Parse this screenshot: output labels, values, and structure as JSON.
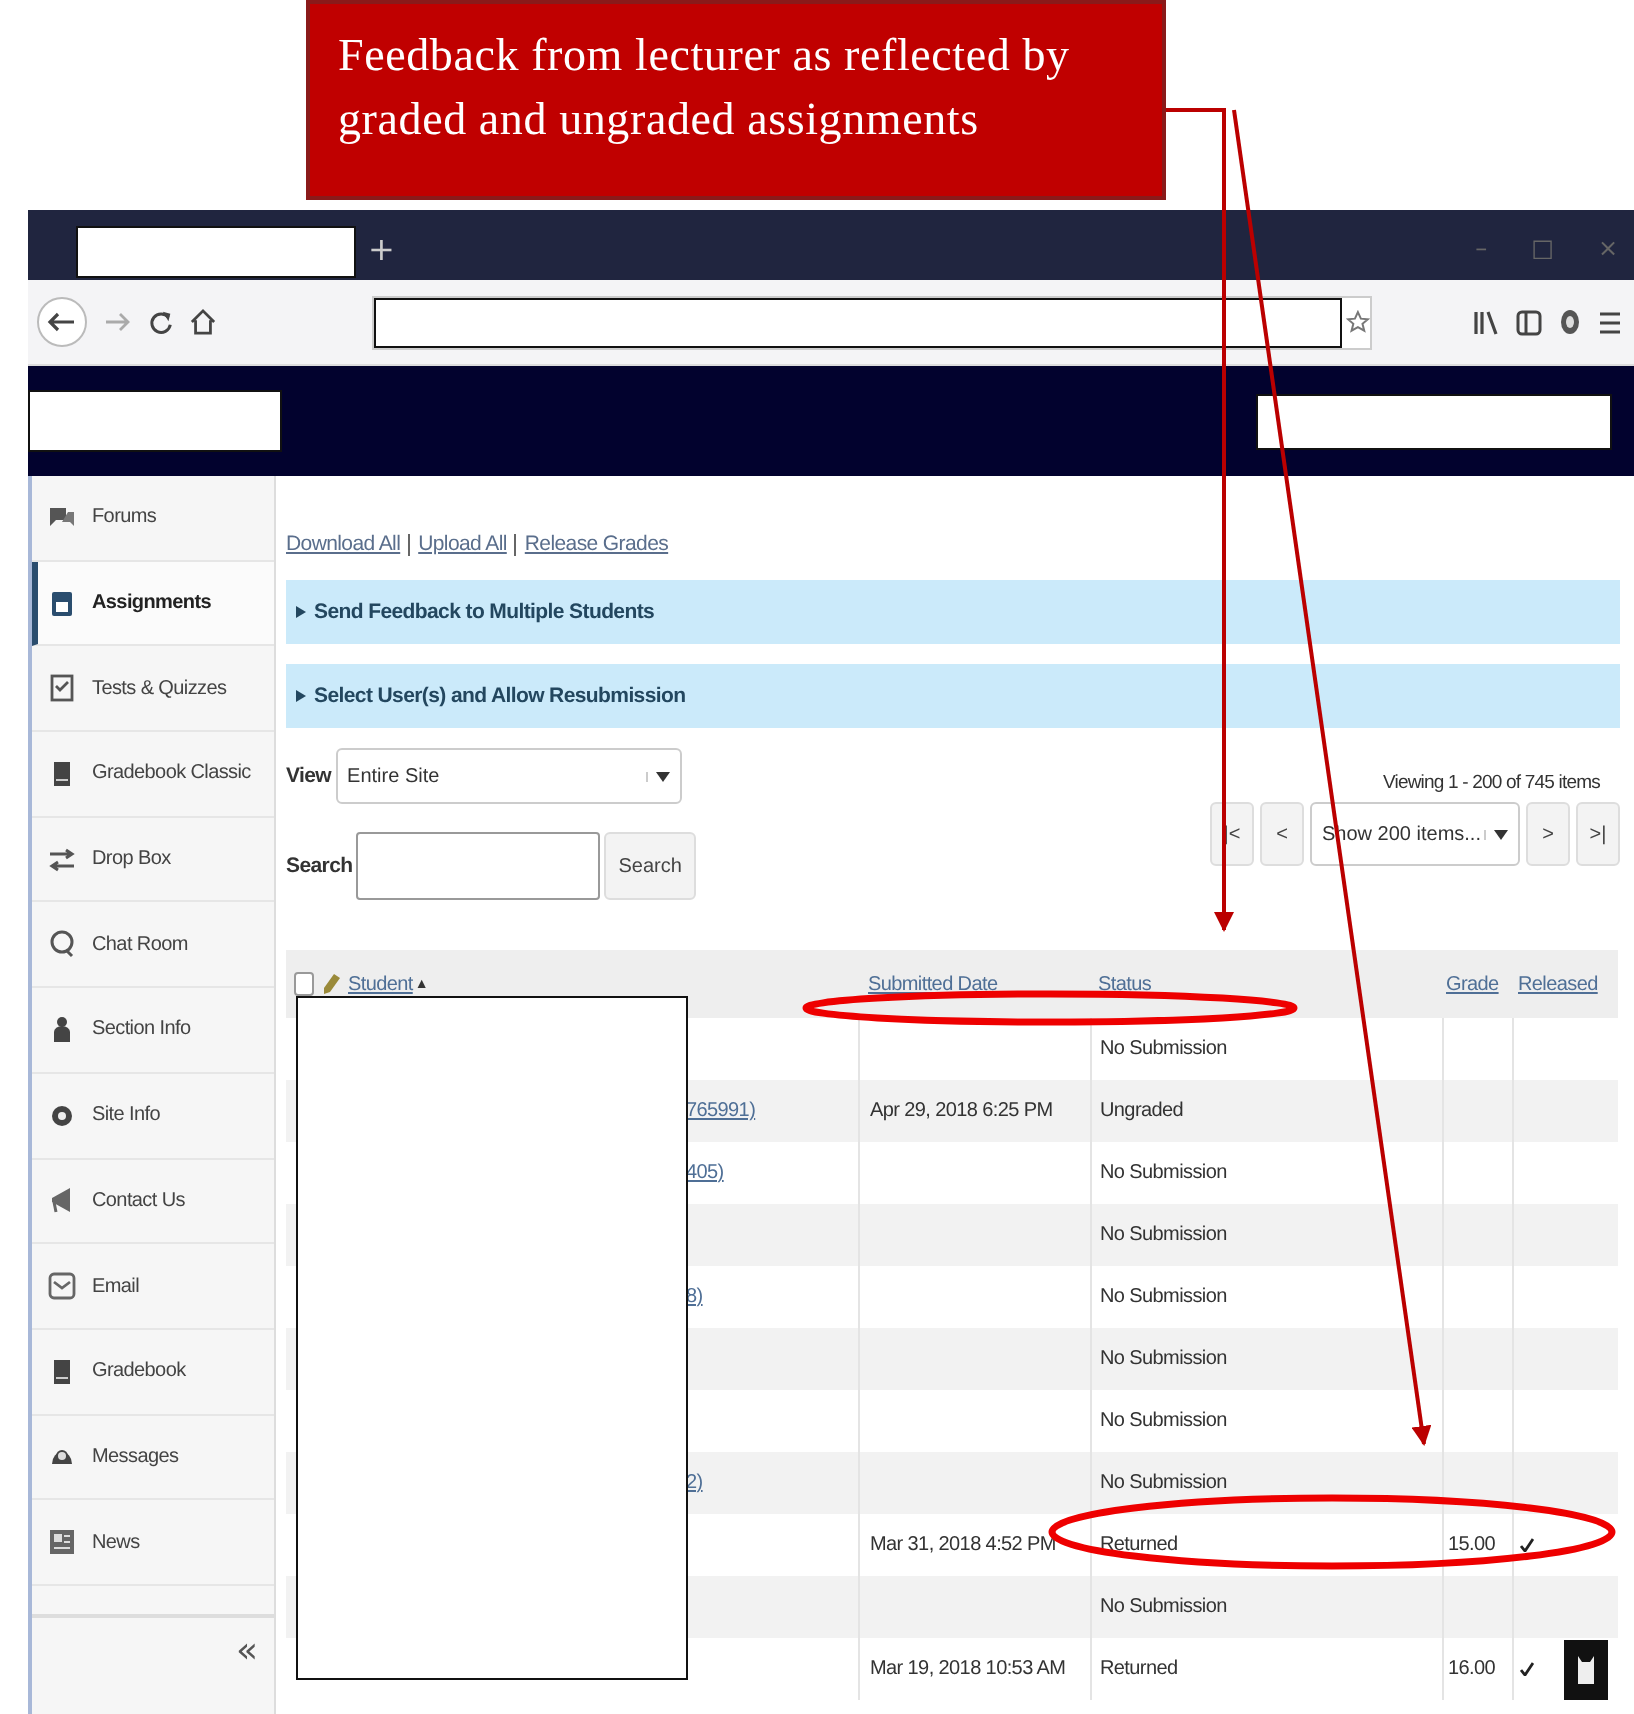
{
  "annotation": {
    "text": "Feedback from lecturer as reflected by graded and ungraded assignments"
  },
  "browser": {
    "new_tab": "+",
    "window_controls": [
      "–",
      "□",
      "×"
    ]
  },
  "sidebar": {
    "items": [
      {
        "label": "Forums",
        "selected": false
      },
      {
        "label": "Assignments",
        "selected": true
      },
      {
        "label": "Tests & Quizzes",
        "selected": false
      },
      {
        "label": "Gradebook Classic",
        "selected": false
      },
      {
        "label": "Drop Box",
        "selected": false
      },
      {
        "label": "Chat Room",
        "selected": false
      },
      {
        "label": "Section Info",
        "selected": false
      },
      {
        "label": "Site Info",
        "selected": false
      },
      {
        "label": "Contact Us",
        "selected": false
      },
      {
        "label": "Email",
        "selected": false
      },
      {
        "label": "Gradebook",
        "selected": false
      },
      {
        "label": "Messages",
        "selected": false
      },
      {
        "label": "News",
        "selected": false
      }
    ],
    "collapse": "«"
  },
  "main": {
    "links": [
      "Download All",
      "Upload All",
      "Release Grades"
    ],
    "sections": [
      {
        "label": "Send Feedback to Multiple Students",
        "expanded": false
      },
      {
        "label": "Select User(s) and Allow Resubmission",
        "expanded": false
      }
    ],
    "view": {
      "label": "View",
      "value": "Entire Site"
    },
    "search": {
      "label": "Search",
      "button": "Search"
    },
    "pager": {
      "info": "Viewing 1 - 200 of 745 items",
      "first": "|<",
      "prev": "<",
      "page_size": "Show 200 items...",
      "next": ">",
      "last": ">|"
    }
  },
  "table": {
    "select_all": {
      "checked": false
    },
    "sort_mark": "▲",
    "columns": [
      "Student",
      "Submitted Date",
      "Status",
      "Grade",
      "Released"
    ],
    "rows": [
      {
        "status": "No Submission",
        "released": false
      },
      {
        "link": "765991)",
        "submitted": "Apr 29, 2018 6:25 PM",
        "status": "Ungraded",
        "released": false
      },
      {
        "link": "405)",
        "status": "No Submission",
        "released": false
      },
      {
        "status": "No Submission",
        "released": false
      },
      {
        "link": "8)",
        "status": "No Submission",
        "released": false
      },
      {
        "status": "No Submission",
        "released": false
      },
      {
        "status": "No Submission",
        "released": false
      },
      {
        "link": "2)",
        "status": "No Submission",
        "released": false
      },
      {
        "submitted": "Mar 31, 2018 4:52 PM",
        "status": "Returned",
        "grade": "15.00",
        "released": true
      },
      {
        "status": "No Submission",
        "released": false
      },
      {
        "submitted": "Mar 19, 2018 10:53 AM",
        "status": "Returned",
        "grade": "16.00",
        "released": true
      }
    ]
  }
}
